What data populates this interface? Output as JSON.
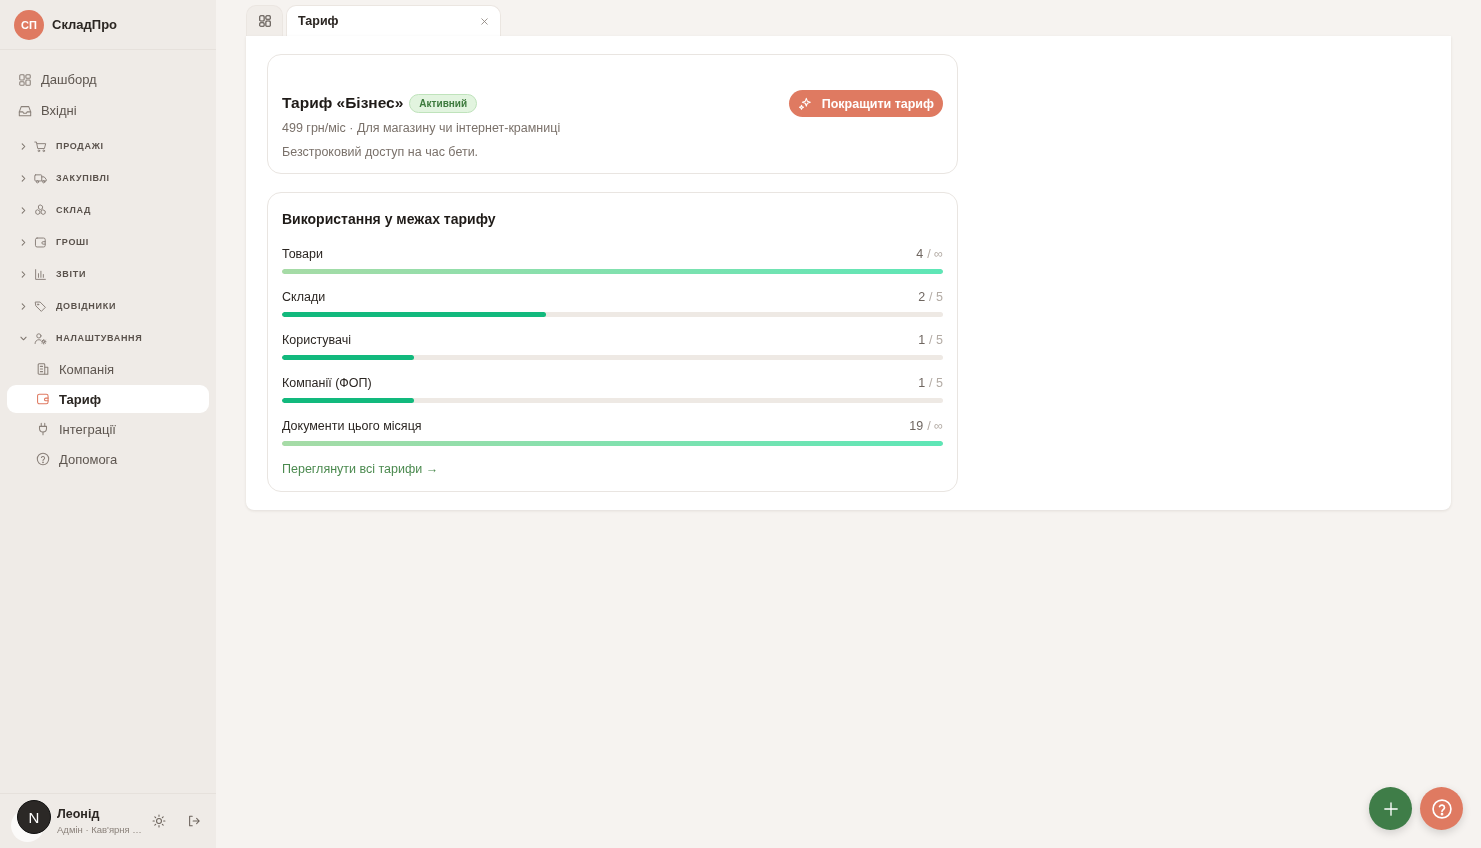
{
  "app": {
    "logo_initials": "СП",
    "name": "СкладПро"
  },
  "sidebar": {
    "items": [
      {
        "kind": "link",
        "label": "Дашборд",
        "selected": false
      },
      {
        "kind": "link",
        "label": "Вхідні",
        "selected": false
      },
      {
        "kind": "group",
        "label": "ПРОДАЖІ",
        "expanded": false
      },
      {
        "kind": "group",
        "label": "ЗАКУПІВЛІ",
        "expanded": false
      },
      {
        "kind": "group",
        "label": "СКЛАД",
        "expanded": false
      },
      {
        "kind": "group",
        "label": "ГРОШІ",
        "expanded": false
      },
      {
        "kind": "group",
        "label": "ЗВІТИ",
        "expanded": false
      },
      {
        "kind": "group",
        "label": "ДОВІДНИКИ",
        "expanded": false
      },
      {
        "kind": "group",
        "label": "НАЛАШТУВАННЯ",
        "expanded": true,
        "children": [
          {
            "label": "Компанія",
            "selected": false
          },
          {
            "label": "Тариф",
            "selected": true
          },
          {
            "label": "Інтеграції",
            "selected": false
          },
          {
            "label": "Допомога",
            "selected": false
          }
        ]
      }
    ]
  },
  "user": {
    "initial": "N",
    "name": "Леонід",
    "subtitle": "Адмін · Кав'ярня …"
  },
  "tabs": [
    {
      "kind": "icon",
      "selected": false
    },
    {
      "kind": "page",
      "label": "Тариф",
      "selected": true
    }
  ],
  "plan_card": {
    "title": "Тариф «Бізнес»",
    "badge": "Активний",
    "price_line": "499 грн/міс · Для магазину чи інтернет-крамниці",
    "note": "Безстроковий доступ на час бети.",
    "button": "Покращити тариф"
  },
  "usage": {
    "title": "Використання у межах тарифу",
    "rows": [
      {
        "kind": "unlimited",
        "label": "Товари",
        "used": "4",
        "limit": "/ ∞",
        "level": 1
      },
      {
        "kind": "limited",
        "label": "Склади",
        "used": "2",
        "limit": "/ 5",
        "level": 0.4
      },
      {
        "kind": "limited",
        "label": "Користувачі",
        "used": "1",
        "limit": "/ 5",
        "level": 0.2
      },
      {
        "kind": "limited",
        "label": "Компанії (ФОП)",
        "used": "1",
        "limit": "/ 5",
        "level": 0.2
      },
      {
        "kind": "unlimited",
        "label": "Документи цього місяця",
        "used": "19",
        "limit": "/ ∞",
        "level": 1
      }
    ],
    "link": "Переглянути всі тарифи →"
  }
}
